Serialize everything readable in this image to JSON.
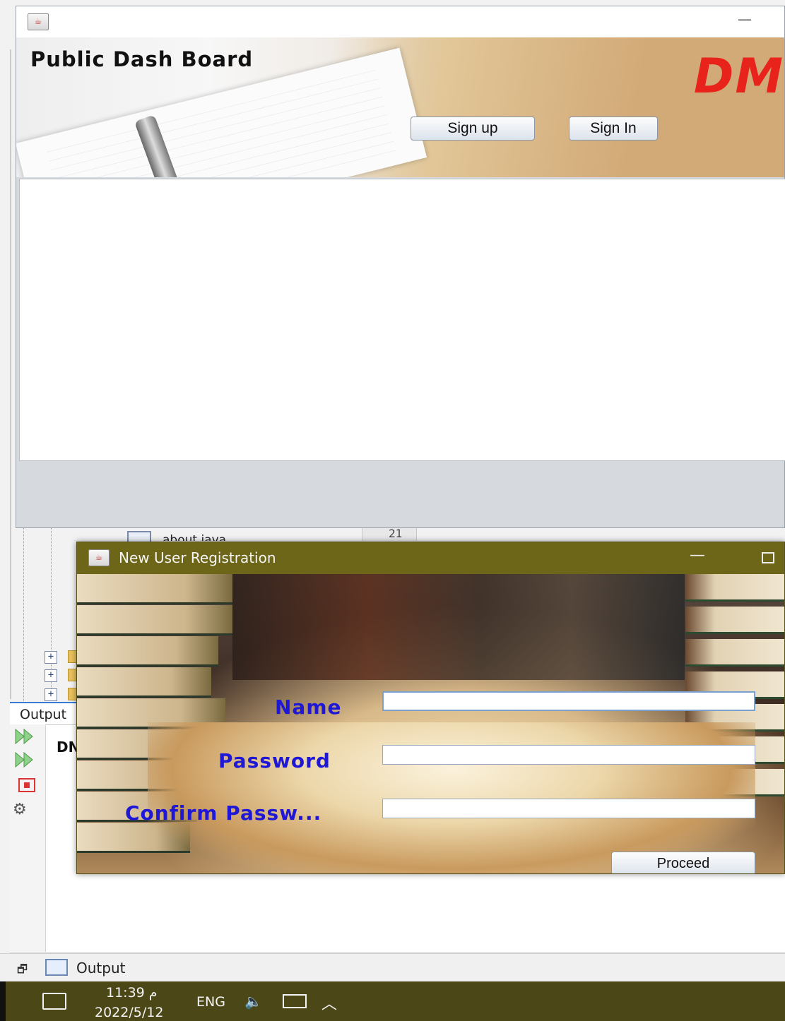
{
  "ide": {
    "file_label": "about.java",
    "line_number": "21",
    "output_tab_label": "Output",
    "output_text": "DN",
    "bottom_output_label": "Output"
  },
  "dashboard": {
    "title": "Public Dash Board",
    "logo_text": "DM",
    "signup_label": "Sign up",
    "signin_label": "Sign In"
  },
  "registration": {
    "window_title": "New User Registration",
    "labels": {
      "name": "Name",
      "password": "Password",
      "confirm": "Confirm Passw..."
    },
    "fields": {
      "name_value": "",
      "password_value": "",
      "confirm_value": ""
    },
    "proceed_label": "Proceed"
  },
  "taskbar": {
    "time": "11:39 م",
    "date": "2022/5/12",
    "language": "ENG"
  },
  "icons": {
    "app": "java-app-icon",
    "minimize": "minimize-icon",
    "maximize": "maximize-icon",
    "notification": "notification-icon",
    "volume": "volume-icon",
    "network": "network-icon",
    "chevron": "chevron-up-icon"
  },
  "colors": {
    "label_blue": "#1f17d6",
    "logo_red": "#e8231c",
    "reg_titlebar": "#6d6517",
    "taskbar": "#4c4717"
  }
}
